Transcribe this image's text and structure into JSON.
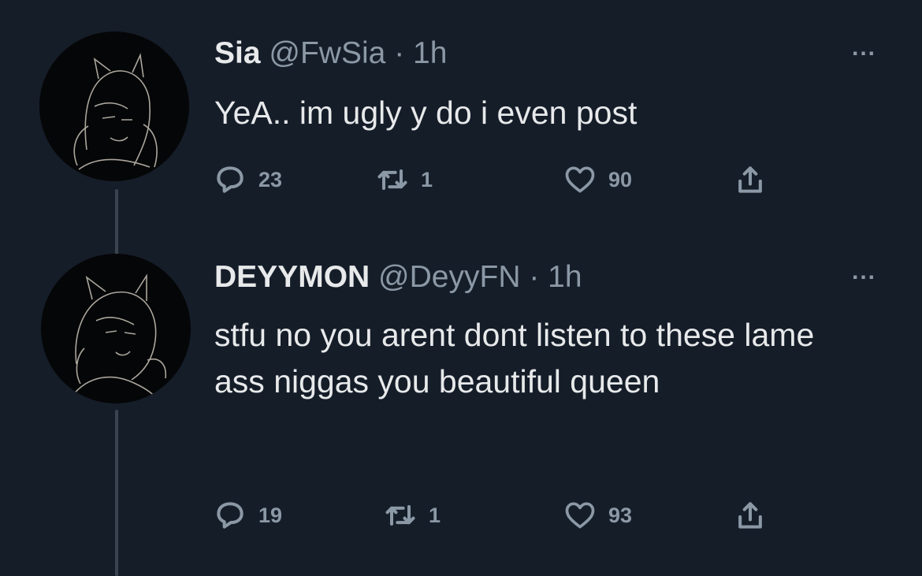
{
  "tweets": [
    {
      "name": "Sia",
      "handle": "@FwSia",
      "dot": "·",
      "time": "1h",
      "text": "YeA.. im ugly y do i even post",
      "replies": "23",
      "retweets": "1",
      "likes": "90",
      "more": "..."
    },
    {
      "name": "DEYYMON",
      "handle": "@DeyyFN",
      "dot": "·",
      "time": "1h",
      "text": "stfu no you arent dont listen to these lame ass niggas you beautiful queen",
      "replies": "19",
      "retweets": "1",
      "likes": "93",
      "more": "..."
    }
  ],
  "colors": {
    "background": "#151d29",
    "text": "#e7e9ea",
    "muted": "#8b98a5",
    "thread_line": "#3a4450"
  },
  "icons": [
    "reply-icon",
    "retweet-icon",
    "like-icon",
    "share-icon",
    "more-icon"
  ]
}
